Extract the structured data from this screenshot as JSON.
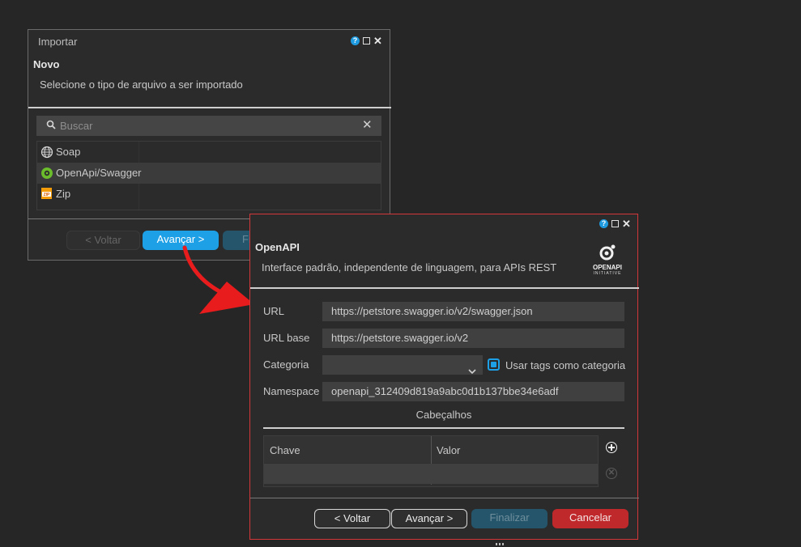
{
  "import_dialog": {
    "title": "Importar",
    "section_title": "Novo",
    "description": "Selecione o tipo de arquivo a ser importado",
    "search": {
      "placeholder": "Buscar"
    },
    "items": [
      {
        "label": "Soap",
        "icon": "globe-icon"
      },
      {
        "label": "OpenApi/Swagger",
        "icon": "swagger-icon"
      },
      {
        "label": "Zip",
        "icon": "zip-icon"
      }
    ],
    "buttons": {
      "back": "< Voltar",
      "next": "Avançar >",
      "finish_partial": "Fi"
    }
  },
  "openapi_dialog": {
    "title": "OpenAPI",
    "description": "Interface padrão, independente de linguagem, para APIs REST",
    "logo_text_1": "OPENAPI",
    "logo_text_2": "INITIATIVE",
    "fields": {
      "url_label": "URL",
      "url_value": "https://petstore.swagger.io/v2/swagger.json",
      "base_url_label": "URL base",
      "base_url_value": "https://petstore.swagger.io/v2",
      "category_label": "Categoria",
      "category_value": "",
      "use_tags_label": "Usar tags como categoria",
      "use_tags_checked": true,
      "namespace_label": "Namespace",
      "namespace_value": "openapi_312409d819a9abc0d1b137bbe34e6adf"
    },
    "headers_section": "Cabeçalhos",
    "table": {
      "columns": [
        "Chave",
        "Valor"
      ],
      "rows": [
        [
          "",
          ""
        ]
      ]
    },
    "buttons": {
      "back": "< Voltar",
      "next": "Avançar >",
      "finish": "Finalizar",
      "cancel": "Cancelar"
    }
  },
  "colors": {
    "accent": "#1ea0e6",
    "cancel": "#c0292b",
    "arrow": "#e81c1c",
    "border_highlight": "#d3373a"
  }
}
